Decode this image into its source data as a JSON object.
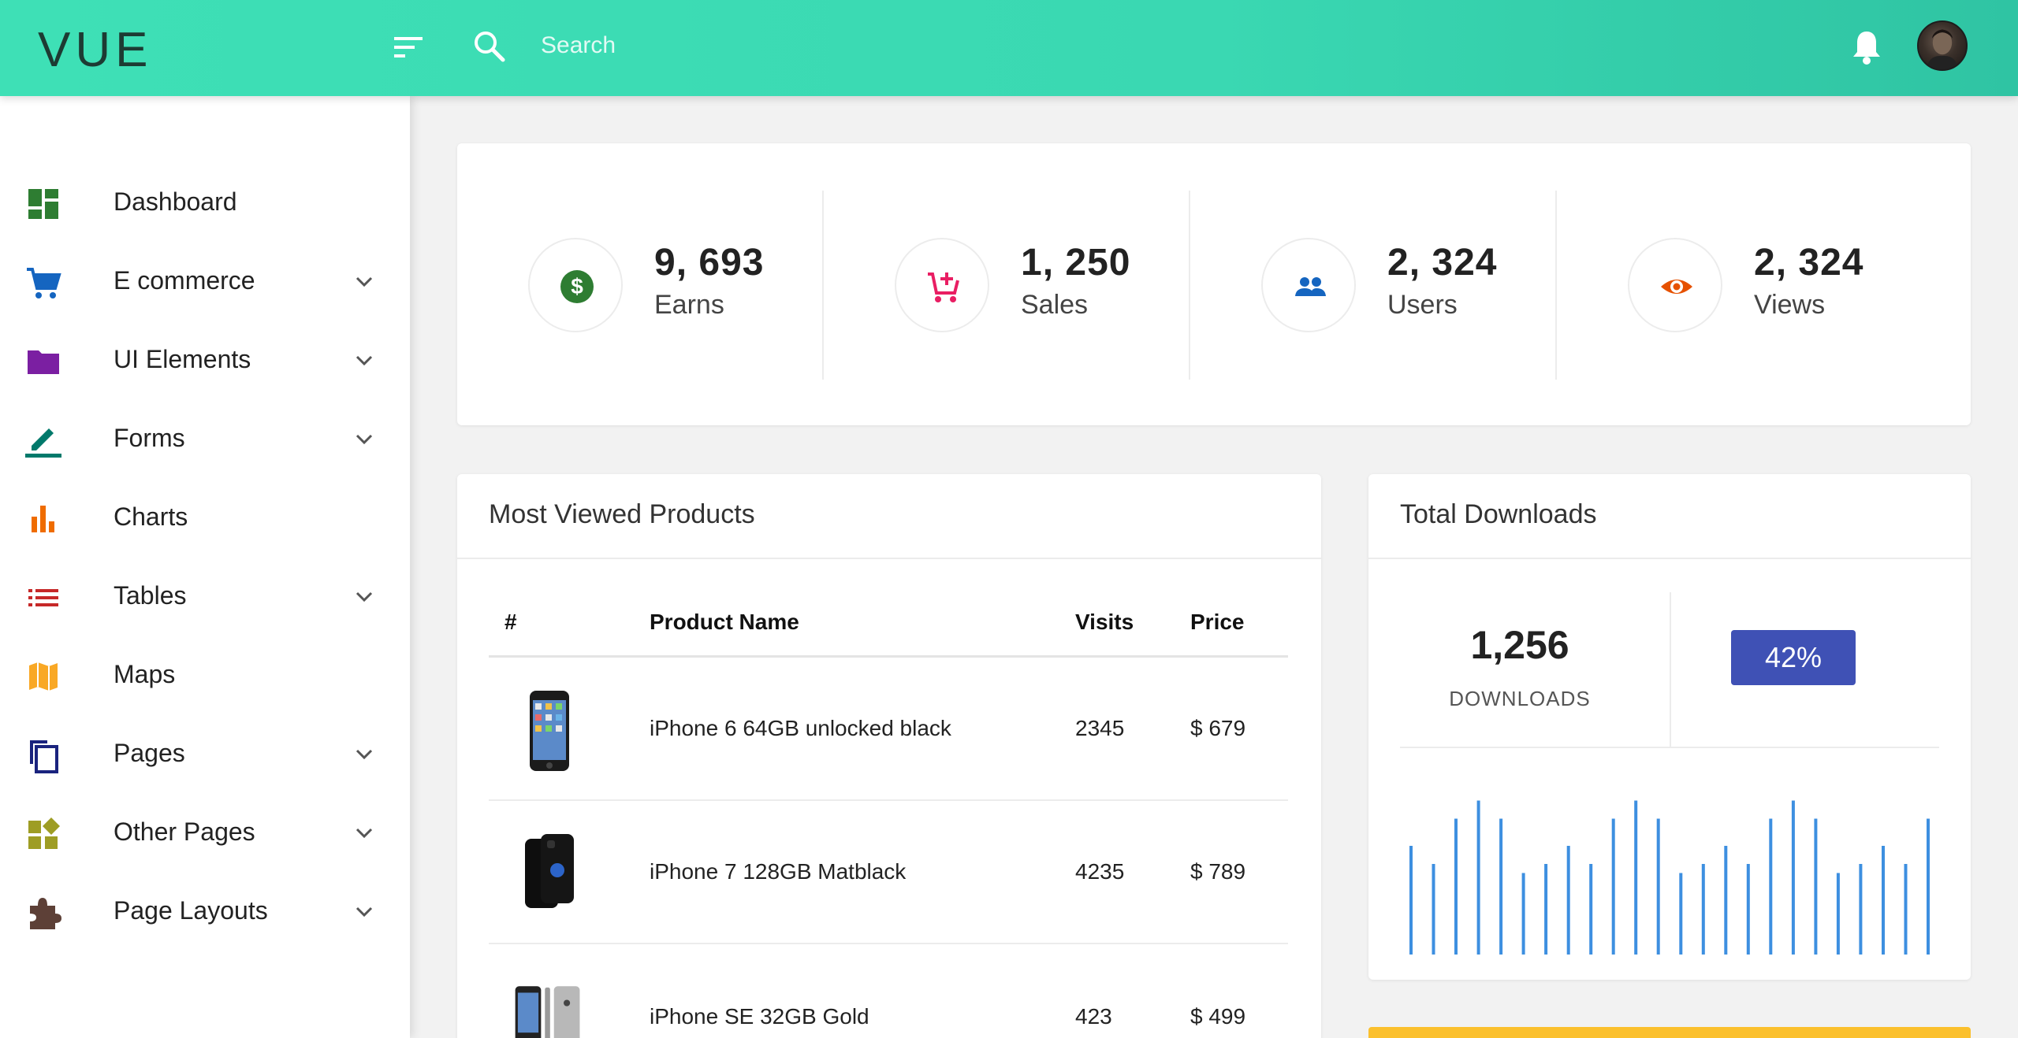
{
  "header": {
    "logo_text": "VUE",
    "search_placeholder": "Search",
    "colors": {
      "gradient_start": "#3ee0b6",
      "gradient_end": "#2fc4a3"
    }
  },
  "sidebar": {
    "items": [
      {
        "label": "Dashboard",
        "icon": "dashboard-icon",
        "color": "#2e7d32",
        "expandable": false
      },
      {
        "label": "E commerce",
        "icon": "cart-icon",
        "color": "#1565c0",
        "expandable": true
      },
      {
        "label": "UI Elements",
        "icon": "folder-icon",
        "color": "#7b1fa2",
        "expandable": true
      },
      {
        "label": "Forms",
        "icon": "pencil-icon",
        "color": "#00796b",
        "expandable": true
      },
      {
        "label": "Charts",
        "icon": "bar-chart-icon",
        "color": "#ef6c00",
        "expandable": false
      },
      {
        "label": "Tables",
        "icon": "list-icon",
        "color": "#c62828",
        "expandable": true
      },
      {
        "label": "Maps",
        "icon": "map-icon",
        "color": "#f9a825",
        "expandable": false
      },
      {
        "label": "Pages",
        "icon": "pages-icon",
        "color": "#1a237e",
        "expandable": true
      },
      {
        "label": "Other Pages",
        "icon": "widgets-icon",
        "color": "#9e9d24",
        "expandable": true
      },
      {
        "label": "Page Layouts",
        "icon": "puzzle-icon",
        "color": "#5d4037",
        "expandable": true
      }
    ]
  },
  "stats": [
    {
      "value": "9, 693",
      "label": "Earns",
      "icon": "dollar-icon",
      "color": "#2e7d32"
    },
    {
      "value": "1, 250",
      "label": "Sales",
      "icon": "add-cart-icon",
      "color": "#e91e63"
    },
    {
      "value": "2, 324",
      "label": "Users",
      "icon": "people-icon",
      "color": "#1565c0"
    },
    {
      "value": "2, 324",
      "label": "Views",
      "icon": "eye-icon",
      "color": "#e65100"
    }
  ],
  "products": {
    "title": "Most Viewed Products",
    "columns": [
      "#",
      "Product Name",
      "Visits",
      "Price"
    ],
    "rows": [
      {
        "name": "iPhone 6 64GB unlocked black",
        "visits": "2345",
        "price": "$ 679"
      },
      {
        "name": "iPhone 7 128GB Matblack",
        "visits": "4235",
        "price": "$ 789"
      },
      {
        "name": "iPhone SE 32GB Gold",
        "visits": "423",
        "price": "$ 499"
      }
    ]
  },
  "downloads": {
    "title": "Total Downloads",
    "value": "1,256",
    "label": "DOWNLOADS",
    "percent": "42%",
    "badge_color": "#3f51b5",
    "bar_color": "#3d8fe0"
  },
  "chart_data": {
    "type": "bar",
    "values": [
      6,
      5,
      7.5,
      8.5,
      7.5,
      4.5,
      5,
      6,
      5,
      7.5,
      8.5,
      7.5,
      4.5,
      5,
      6,
      5,
      7.5,
      8.5,
      7.5,
      4.5,
      5,
      6,
      5,
      7.5
    ],
    "ylim": [
      0,
      10
    ]
  }
}
